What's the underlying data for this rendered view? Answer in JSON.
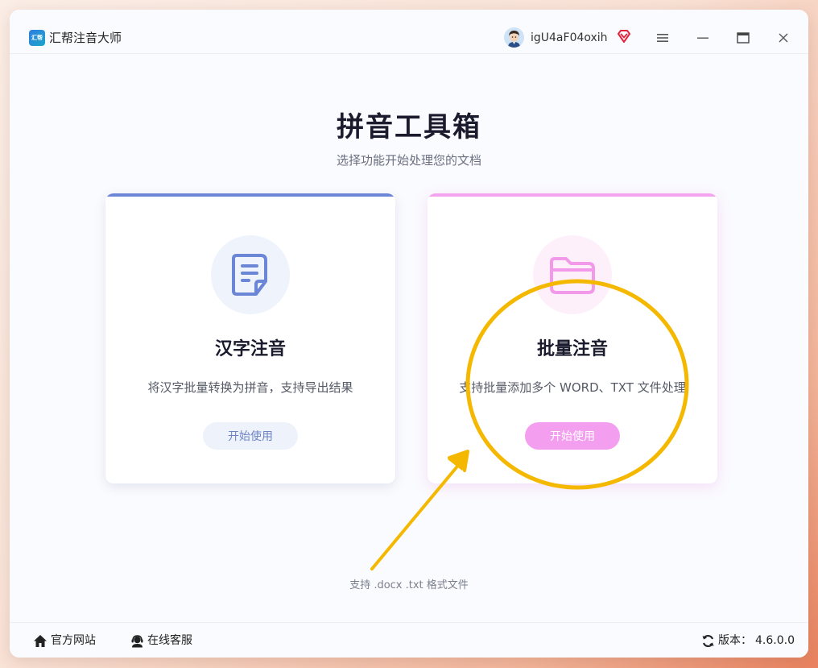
{
  "app": {
    "title": "汇帮注音大师",
    "logo_text": "汇帮"
  },
  "user": {
    "name": "igU4aF04oxih"
  },
  "icons": {
    "menu": "menu-icon",
    "minimize": "minimize-icon",
    "maximize": "maximize-icon",
    "close": "close-icon",
    "vip": "vip-diamond-icon",
    "home": "home-icon",
    "support": "headset-icon",
    "refresh": "refresh-icon"
  },
  "main": {
    "title": "拼音工具箱",
    "subtitle": "选择功能开始处理您的文档",
    "formats_note": "支持 .docx .txt 格式文件"
  },
  "cards": [
    {
      "title": "汉字注音",
      "description": "将汉字批量转换为拼音，支持导出结果",
      "button": "开始使用",
      "icon": "document-icon",
      "accent": "#6b86d6"
    },
    {
      "title": "批量注音",
      "description": "支持批量添加多个 WORD、TXT 文件处理",
      "button": "开始使用",
      "icon": "folder-icon",
      "accent": "#f4a3ef"
    }
  ],
  "footer": {
    "website": "官方网站",
    "support": "在线客服",
    "version_label": "版本：",
    "version": "4.6.0.0"
  },
  "annotation_color": "#f5b800"
}
